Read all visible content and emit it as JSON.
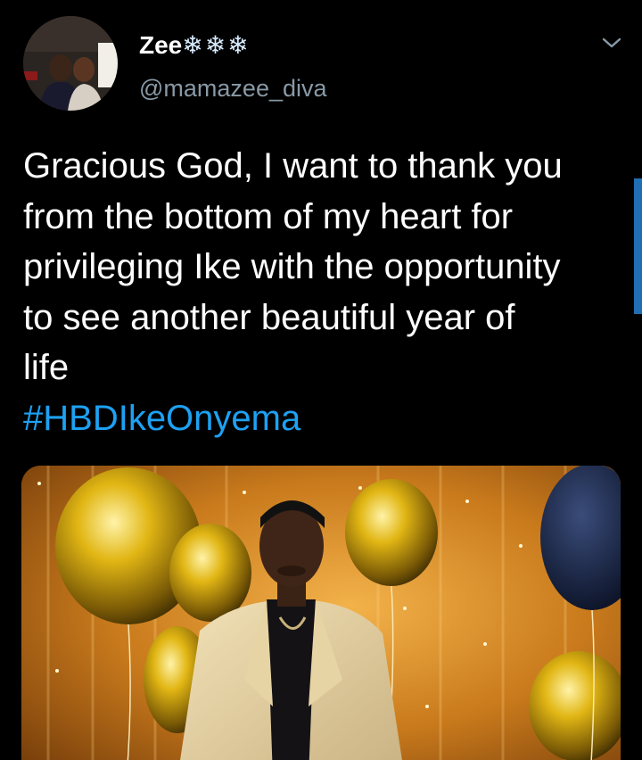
{
  "tweet": {
    "display_name": "Zee",
    "display_name_emoji": "❄❄❄",
    "username": "@mamazee_diva",
    "text_lines": [
      "Gracious God, I want to thank you",
      "from the bottom of my heart for",
      "privileging Ike with the opportunity",
      "to see another beautiful year of",
      "life"
    ],
    "hashtag": "#HBDIkeOnyema"
  },
  "colors": {
    "background": "#000000",
    "text": "#ffffff",
    "secondary_text": "#8899a6",
    "link": "#1da1f2",
    "scroll_indicator": "#1f6fb2"
  },
  "icons": {
    "caret": "chevron-down-icon",
    "emoji": "snowflake-icon"
  }
}
